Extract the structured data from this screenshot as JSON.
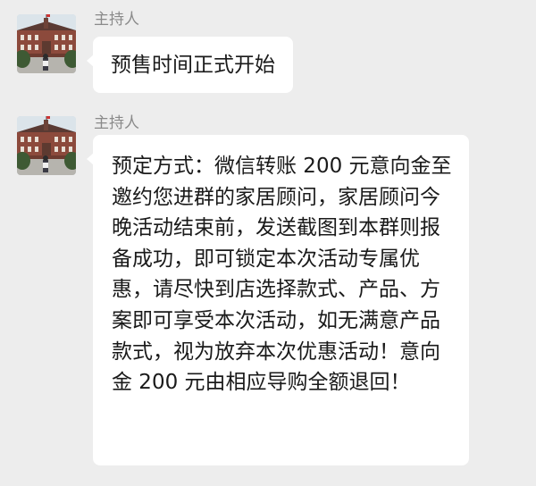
{
  "messages": [
    {
      "sender": "主持人",
      "avatar": "campus-building-avatar",
      "text": "预售时间正式开始"
    },
    {
      "sender": "主持人",
      "avatar": "campus-building-avatar",
      "text": "预定方式：微信转账 200 元意向金至邀约您进群的家居顾问，家居顾问今晚活动结束前，发送截图到本群则报备成功，即可锁定本次活动专属优惠，请尽快到店选择款式、产品、方案即可享受本次活动，如无满意产品款式，视为放弃本次优惠活动！意向金 200 元由相应导购全额退回！"
    }
  ],
  "colors": {
    "background": "#ededed",
    "bubble": "#ffffff",
    "sender_name": "#8a8a8a",
    "message_text": "#1a1a1a"
  }
}
